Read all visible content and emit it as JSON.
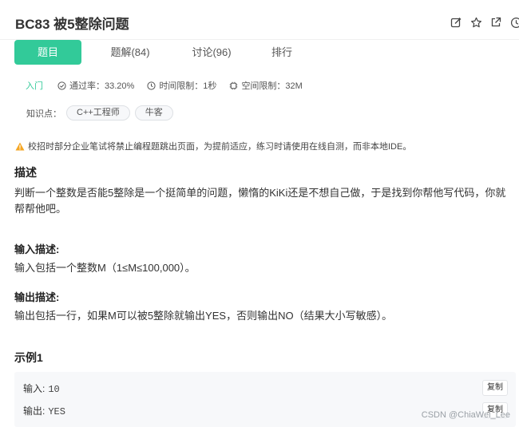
{
  "problem": {
    "title": "BC83  被5整除问题"
  },
  "header_icons": [
    "edit-icon",
    "star-icon",
    "open-external-icon",
    "clock-icon"
  ],
  "tabs": [
    {
      "label": "题目",
      "active": true
    },
    {
      "label": "题解(84)",
      "active": false
    },
    {
      "label": "讨论(96)",
      "active": false
    },
    {
      "label": "排行",
      "active": false
    }
  ],
  "meta": {
    "level": "入门",
    "pass_rate": "通过率：33.20%",
    "time_limit": "时间限制：1秒",
    "memory_limit": "空间限制：32M"
  },
  "knowledge": {
    "label": "知识点：",
    "tags": [
      "C++工程师",
      "牛客"
    ]
  },
  "notice": "校招时部分企业笔试将禁止编程题跳出页面，为提前适应，练习时请使用在线自测，而非本地IDE。",
  "description": {
    "heading": "描述",
    "text": "判断一个整数是否能5整除是一个挺简单的问题，懒惰的KiKi还是不想自己做，于是找到你帮他写代码，你就帮帮他吧。"
  },
  "input_desc": {
    "heading": "输入描述:",
    "text": "输入包括一个整数M（1≤M≤100,000）。"
  },
  "output_desc": {
    "heading": "输出描述:",
    "text": "输出包括一行，如果M可以被5整除就输出YES，否则输出NO（结果大小写敏感）。"
  },
  "example": {
    "heading": "示例1",
    "input_label": "输入:",
    "input_value": "10",
    "output_label": "输出:",
    "output_value": "YES",
    "copy_label": "复制"
  },
  "watermark": "CSDN @ChiaWei_Lee",
  "colors": {
    "accent": "#32ca99",
    "warning": "#f5a623"
  }
}
